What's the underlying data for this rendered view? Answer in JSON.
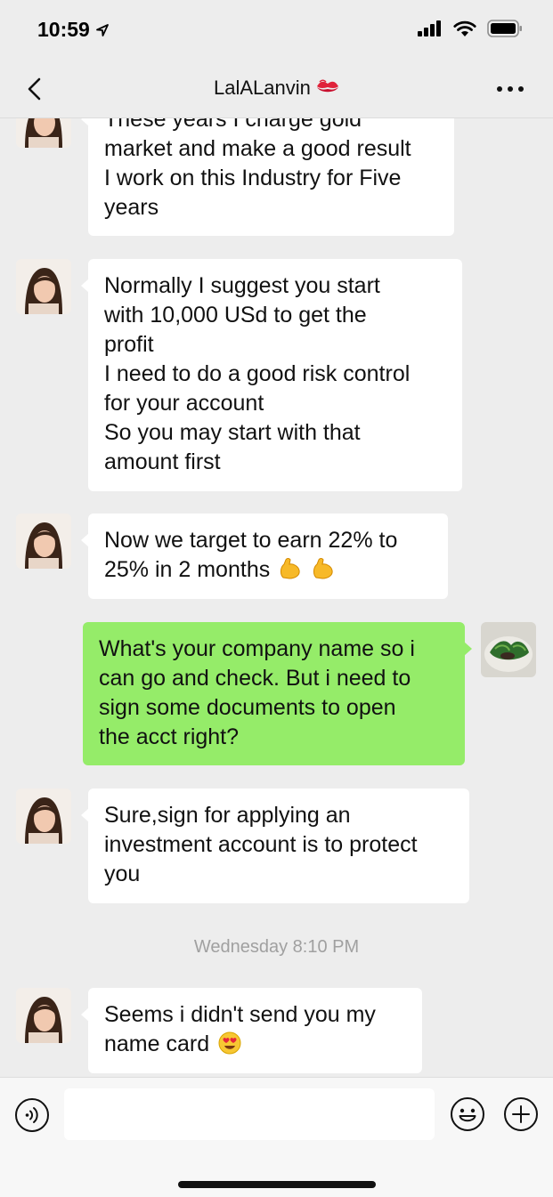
{
  "status_bar": {
    "time": "10:59"
  },
  "header": {
    "title": "LalALanvin",
    "title_emoji": "kiss-lips-icon"
  },
  "messages": [
    {
      "sender": "contact",
      "lines": [
        "These years I charge gold",
        "market and make a good result",
        "I work on this Industry for Five",
        "years"
      ]
    },
    {
      "sender": "contact",
      "lines": [
        "Normally I suggest you start",
        "with 10,000 USd to get the",
        "profit",
        "I need to do a good risk control",
        "for your account",
        "So you may start with that",
        "amount first"
      ]
    },
    {
      "sender": "contact",
      "lines": [
        "Now we target to earn 22% to",
        "25% in 2 months"
      ],
      "trailing_emoji": "flexed-biceps-icon x2"
    },
    {
      "sender": "me",
      "lines": [
        "What's your company name so i",
        "can go and check. But i need to",
        "sign some documents to open",
        "the acct right?"
      ]
    },
    {
      "sender": "contact",
      "lines": [
        "Sure,sign for applying an",
        "investment account is to protect",
        "you"
      ]
    },
    {
      "sender": "contact",
      "lines": [
        "Seems i didn't send you my",
        "name card"
      ],
      "trailing_emoji": "heart-eyes-icon"
    }
  ],
  "timestamp": "Wednesday 8:10 PM",
  "input": {
    "placeholder": ""
  },
  "colors": {
    "background": "#ededed",
    "outgoing_bubble": "#95ec69",
    "incoming_bubble": "#ffffff"
  }
}
